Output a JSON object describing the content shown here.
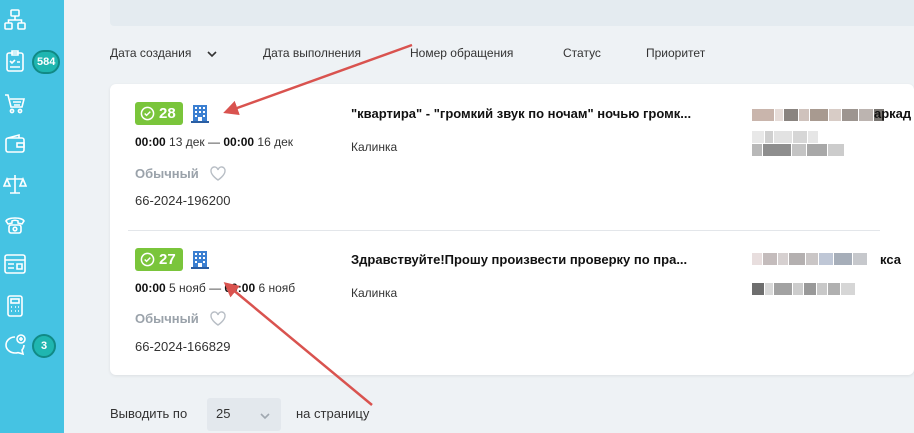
{
  "sidebar": {
    "items": [
      {
        "icon": "org-structure-icon",
        "badge": ""
      },
      {
        "icon": "checklist-icon",
        "badge": "584"
      },
      {
        "icon": "cart-icon",
        "badge": ""
      },
      {
        "icon": "wallet-icon",
        "badge": ""
      },
      {
        "icon": "scales-icon",
        "badge": ""
      },
      {
        "icon": "phone-icon",
        "badge": ""
      },
      {
        "icon": "browser-window-icon",
        "badge": ""
      },
      {
        "icon": "calculator-icon",
        "badge": ""
      },
      {
        "icon": "chat-add-icon",
        "badge": "3"
      }
    ]
  },
  "sort": {
    "created": "Дата создания",
    "completed": "Дата выполнения",
    "request_number": "Номер обращения",
    "status": "Статус",
    "priority": "Приоритет"
  },
  "requests": [
    {
      "count": "28",
      "start_time": "00:00",
      "start_date": "13 дек",
      "separator": "—",
      "end_time": "00:00",
      "end_date": "16 дек",
      "priority": "Обычный",
      "number": "66-2024-196200",
      "title": "\"квартира\" - \"громкий звук по ночам\" ночью громк...",
      "address": "Калинка",
      "extra": "аркад"
    },
    {
      "count": "27",
      "start_time": "00:00",
      "start_date": "5 нояб",
      "separator": "—",
      "end_time": "00:00",
      "end_date": "6 нояб",
      "priority": "Обычный",
      "number": "66-2024-166829",
      "title": "Здравствуйте!Прошу произвести проверку по пра...",
      "address": "Калинка",
      "extra": "кса"
    }
  ],
  "pagination": {
    "label_before": "Выводить по",
    "page_size": "25",
    "label_after": "на страницу"
  },
  "colors": {
    "sidebar": "#45c3e3",
    "badge_green": "#7ac53b",
    "counter": "#1fb6b0",
    "annotation_arrow": "#d9534f"
  }
}
